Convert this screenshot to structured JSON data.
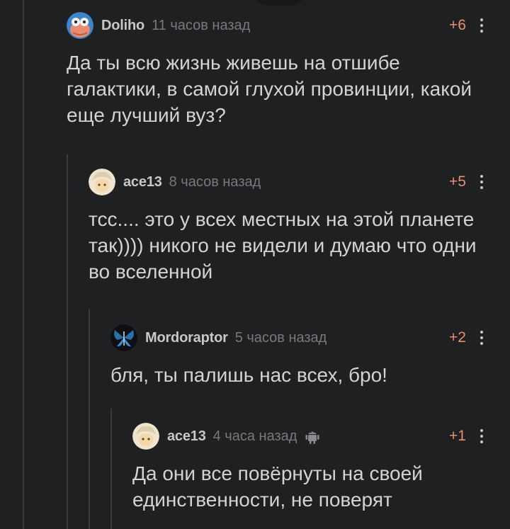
{
  "comments": [
    {
      "author": "Doliho",
      "time": "11 часов назад",
      "rating": "+6",
      "text": "Да ты всю жизнь живешь на отшибе галактики, в самой глухой провинции, какой еще лучший вуз?",
      "avatar": "zoidberg-avatar"
    },
    {
      "author": "ace13",
      "time": "8 часов назад",
      "rating": "+5",
      "text": "тсс.... это у всех местных на этой планете так)))) никого не видели и думаю что одни во вселенной",
      "avatar": "anime-avatar"
    },
    {
      "author": "Mordoraptor",
      "time": "5 часов назад",
      "rating": "+2",
      "text": "бля, ты палишь нас всех, бро!",
      "avatar": "butterfly-avatar"
    },
    {
      "author": "ace13",
      "time": "4 часа назад",
      "rating": "+1",
      "text": "Да они все повёрнуты на своей единственности, не поверят",
      "avatar": "anime-avatar",
      "platform_icon": "android-icon"
    }
  ],
  "colors": {
    "background": "#1f2022",
    "rating": "#ea8e71",
    "thread_line": "#3a3b3d"
  }
}
